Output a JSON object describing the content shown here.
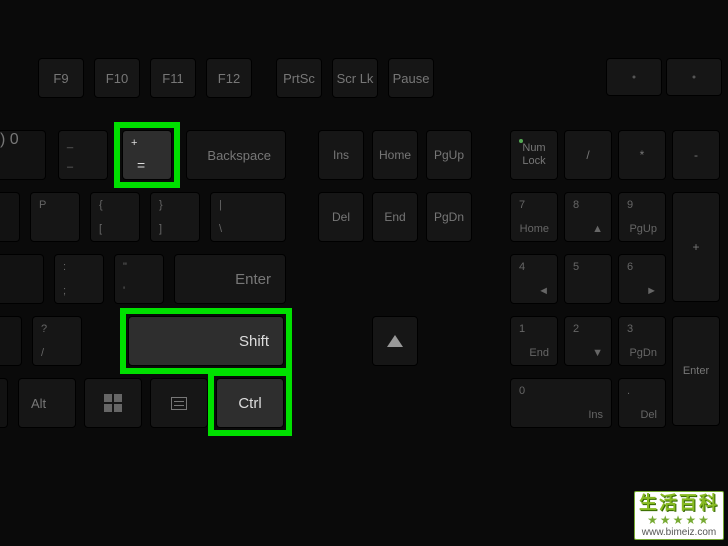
{
  "function_row": {
    "f9": "F9",
    "f10": "F10",
    "f11": "F11",
    "f12": "F12",
    "prtsc": "PrtSc",
    "scrlk": "Scr Lk",
    "pause": "Pause"
  },
  "row1": {
    "zero_top": ")",
    "zero_bot": "0",
    "minus_top": "_",
    "minus_bot": "–",
    "plus_top": "+",
    "plus_bot": "=",
    "backspace": "Backspace",
    "ins": "Ins",
    "home": "Home",
    "pgup": "PgUp",
    "numlock": "Num\nLock",
    "div": "/",
    "mul": "*",
    "sub": "-"
  },
  "row2": {
    "p": "P",
    "lb_top": "{",
    "lb_bot": "[",
    "rb_top": "}",
    "rb_bot": "]",
    "bs_top": "|",
    "bs_bot": "\\",
    "del": "Del",
    "end": "End",
    "pgdn": "PgDn",
    "n7": "7",
    "n7s": "Home",
    "n8": "8",
    "n8s": "▲",
    "n9": "9",
    "n9s": "PgUp",
    "plus": "+"
  },
  "row3": {
    "semi_top": ":",
    "semi_bot": ";",
    "quote_top": "\"",
    "quote_bot": "'",
    "enter": "Enter",
    "n4": "4",
    "n4s": "◄",
    "n5": "5",
    "n6": "6",
    "n6s": "►"
  },
  "row4": {
    "slash_top": "?",
    "slash_bot": "/",
    "shift": "Shift",
    "up": "▲",
    "n1": "1",
    "n1s": "End",
    "n2": "2",
    "n2s": "▼",
    "n3": "3",
    "n3s": "PgDn",
    "enter": "Enter"
  },
  "row5": {
    "alt": "Alt",
    "ctrl": "Ctrl",
    "n0": "0",
    "n0s": "Ins",
    "ndot": ".",
    "ndots": "Del"
  },
  "highlighted_keys": [
    "plus-equals",
    "shift",
    "ctrl"
  ],
  "watermark": {
    "title_cn": "生活百科",
    "url": "www.bimeiz.com",
    "stars": "★★★★★"
  }
}
